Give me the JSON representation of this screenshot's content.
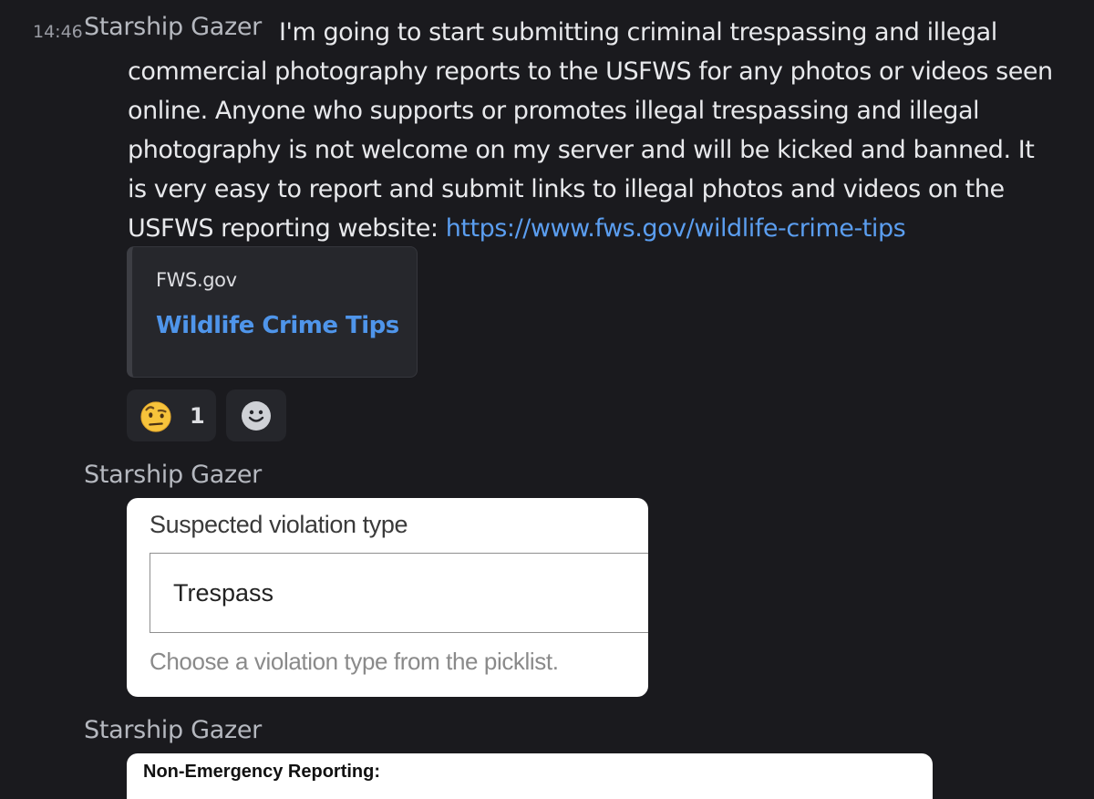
{
  "messages": [
    {
      "timestamp": "14:46",
      "author": "Starship Gazer",
      "text": "I'm going to start submitting criminal trespassing and illegal commercial photography reports to the USFWS for any photos or videos seen online. Anyone who supports or promotes illegal trespassing and illegal photography is not welcome on my server and will be kicked and banned. It is very easy to report and submit links to illegal photos and videos on the USFWS reporting website: ",
      "link": "https://www.fws.gov/wildlife-crime-tips",
      "embed": {
        "provider": "FWS.gov",
        "title": "Wildlife Crime Tips"
      },
      "reactions": [
        {
          "emoji": "face-with-raised-eyebrow-emoji",
          "count": "1"
        }
      ]
    },
    {
      "author": "Starship Gazer",
      "attachment": {
        "label": "Suspected violation type",
        "value": "Trespass",
        "help": "Choose a violation type from the picklist."
      }
    },
    {
      "author": "Starship Gazer",
      "attachment": {
        "heading": "Non-Emergency Reporting:"
      }
    }
  ],
  "colors": {
    "background": "#1a1a1e",
    "link": "#5b9ef0",
    "embed_title": "#4f95ea",
    "reaction_bg": "#25262b"
  }
}
